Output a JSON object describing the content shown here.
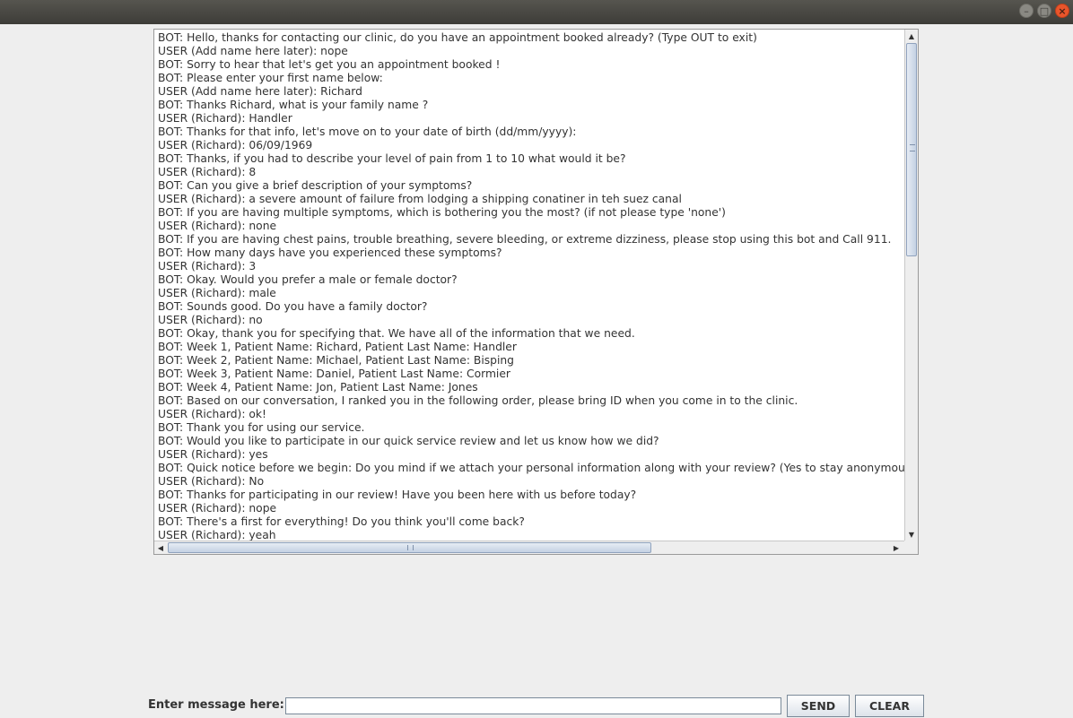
{
  "window": {
    "minimize_icon": "minimize-icon",
    "maximize_icon": "maximize-icon",
    "close_icon": "close-icon",
    "close_color": "#e9552b"
  },
  "chat": {
    "lines": [
      "BOT: Hello, thanks for contacting our clinic, do you have an appointment booked already? (Type OUT to exit)",
      "USER (Add name here later): nope",
      "BOT: Sorry to hear that let's get you an appointment booked !",
      "BOT: Please enter your first name below:",
      "USER (Add name here later): Richard",
      "BOT: Thanks Richard, what is your family name ?",
      "USER (Richard): Handler",
      "BOT: Thanks for that info, let's move on to your date of birth (dd/mm/yyyy):",
      "USER (Richard): 06/09/1969",
      "BOT: Thanks, if you had to describe your level of pain from 1 to 10 what would it be?",
      "USER (Richard): 8",
      "BOT: Can you give a brief description of your symptoms?",
      "USER (Richard): a severe amount of failure from lodging a shipping conatiner in teh suez canal",
      "BOT: If you are having multiple symptoms, which is bothering you the most? (if not please type 'none')",
      "USER (Richard): none",
      "BOT: If you are having chest pains, trouble breathing, severe bleeding, or extreme dizziness, please stop using this bot and Call 911.",
      "BOT: How many days have you experienced these symptoms?",
      "USER (Richard): 3",
      "BOT: Okay. Would you prefer a male or female doctor?",
      "USER (Richard): male",
      "BOT: Sounds good. Do you have a family doctor?",
      "USER (Richard): no",
      "BOT: Okay, thank you for specifying that. We have all of the information that we need.",
      "BOT: Week 1, Patient Name: Richard, Patient Last Name:  Handler",
      "BOT: Week 2, Patient Name: Michael, Patient Last Name:  Bisping",
      "BOT: Week 3, Patient Name: Daniel, Patient Last Name:  Cormier",
      "BOT: Week 4, Patient Name: Jon, Patient Last Name:  Jones",
      "BOT: Based on our conversation, I ranked you in the following order, please bring ID when you come in to the clinic.",
      "USER (Richard): ok!",
      "BOT: Thank you for using our service.",
      "BOT: Would you like to participate in our quick service review and let us know how we did?",
      "USER (Richard): yes",
      "BOT: Quick notice before we begin: Do you mind if we attach your personal information along with your review? (Yes to stay anonymous)",
      "USER (Richard): No",
      "BOT: Thanks for participating in our review! Have you been here with us before today?",
      "USER (Richard): nope",
      "BOT: There's a first for everything! Do you think you'll come back?",
      "USER (Richard): yeah"
    ]
  },
  "scrollbars": {
    "up_icon": "arrow-up-icon",
    "down_icon": "arrow-down-icon",
    "left_icon": "arrow-left-icon",
    "right_icon": "arrow-right-icon",
    "up_glyph": "▲",
    "down_glyph": "▼",
    "left_glyph": "◀",
    "right_glyph": "▶",
    "vertical_position_fraction": 0.0,
    "horizontal_position_fraction": 0.0
  },
  "input_bar": {
    "label": "Enter message here:",
    "value": "",
    "placeholder": "",
    "send_label": "SEND",
    "clear_label": "CLEAR"
  }
}
